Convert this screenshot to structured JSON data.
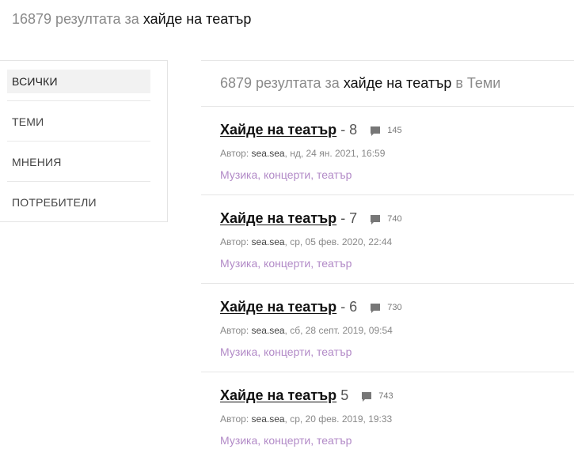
{
  "summary": {
    "count_text": "16879 резултата за",
    "term": "хайде на театър"
  },
  "filters": [
    {
      "label": "ВСИЧКИ",
      "active": true
    },
    {
      "label": "ТЕМИ",
      "active": false
    },
    {
      "label": "МНЕНИЯ",
      "active": false
    },
    {
      "label": "ПОТРЕБИТЕЛИ",
      "active": false
    }
  ],
  "results_header": {
    "count_text": "6879 резултата за",
    "term": "хайде на театър",
    "scope": "в Теми"
  },
  "results": [
    {
      "title": "Хайде на театър",
      "suffix": "- 8",
      "comments": "145",
      "meta_prefix": "Автор:",
      "author": "sea.sea",
      "date": ", нд, 24 ян. 2021, 16:59",
      "tags": "Музика, концерти, театър"
    },
    {
      "title": "Хайде на театър",
      "suffix": "- 7",
      "comments": "740",
      "meta_prefix": "Автор:",
      "author": "sea.sea",
      "date": ", ср, 05 фев. 2020, 22:44",
      "tags": "Музика, концерти, театър"
    },
    {
      "title": "Хайде на театър",
      "suffix": "- 6",
      "comments": "730",
      "meta_prefix": "Автор:",
      "author": "sea.sea",
      "date": ", сб, 28 септ. 2019, 09:54",
      "tags": "Музика, концерти, театър"
    },
    {
      "title": "Хайде на театър",
      "suffix": "5",
      "comments": "743",
      "meta_prefix": "Автор:",
      "author": "sea.sea",
      "date": ", ср, 20 фев. 2019, 19:33",
      "tags": "Музика, концерти, театър"
    }
  ],
  "icons": {
    "comment": "comment-icon"
  },
  "colors": {
    "tag": "#b28ac7",
    "muted": "#8a8a8a"
  }
}
